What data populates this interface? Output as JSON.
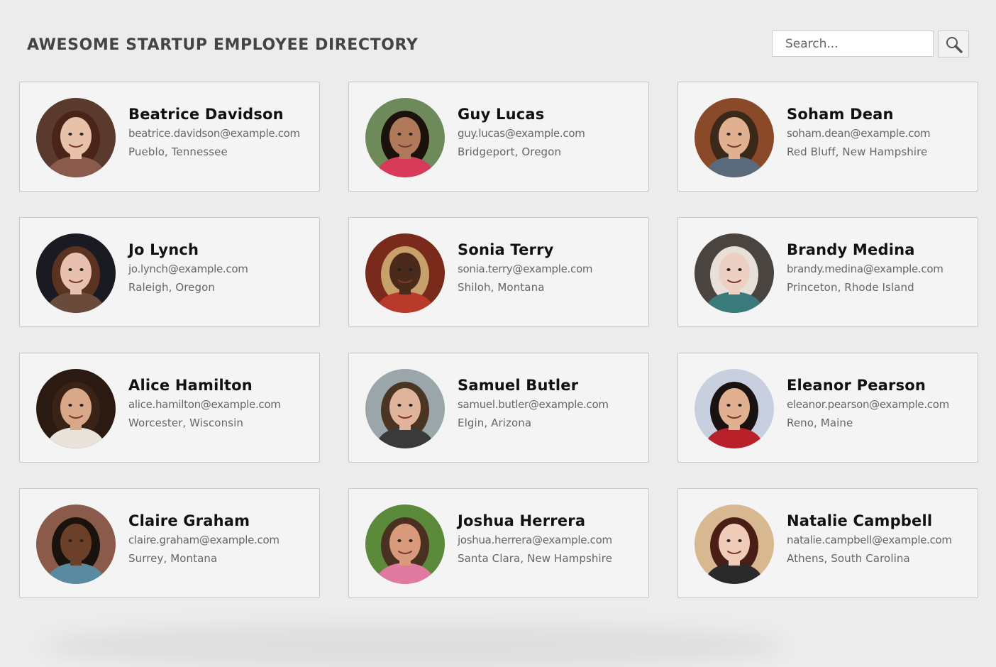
{
  "header": {
    "title": "AWESOME STARTUP EMPLOYEE DIRECTORY",
    "search_placeholder": "Search...",
    "search_icon": "magnifying-glass-icon"
  },
  "employees": [
    {
      "name": "Beatrice Davidson",
      "email": "beatrice.davidson@example.com",
      "location": "Pueblo, Tennessee",
      "colors": {
        "bg": "#5a3a2c",
        "skin": "#e8c2a8",
        "hair": "#4a2418",
        "shirt": "#8a5a4a"
      }
    },
    {
      "name": "Guy Lucas",
      "email": "guy.lucas@example.com",
      "location": "Bridgeport, Oregon",
      "colors": {
        "bg": "#6f8a5a",
        "skin": "#b07a5a",
        "hair": "#1c120c",
        "shirt": "#d83a5a"
      }
    },
    {
      "name": "Soham Dean",
      "email": "soham.dean@example.com",
      "location": "Red Bluff, New Hampshire",
      "colors": {
        "bg": "#8a4a2a",
        "skin": "#e0b090",
        "hair": "#3a2818",
        "shirt": "#5a6a7a"
      }
    },
    {
      "name": "Jo Lynch",
      "email": "jo.lynch@example.com",
      "location": "Raleigh, Oregon",
      "colors": {
        "bg": "#1a1a22",
        "skin": "#e8c0b0",
        "hair": "#5a3220",
        "shirt": "#6a4a3a"
      }
    },
    {
      "name": "Sonia Terry",
      "email": "sonia.terry@example.com",
      "location": "Shiloh, Montana",
      "colors": {
        "bg": "#7a2a1a",
        "skin": "#4a2a1a",
        "hair": "#c8a06a",
        "shirt": "#b83a2a"
      }
    },
    {
      "name": "Brandy Medina",
      "email": "brandy.medina@example.com",
      "location": "Princeton, Rhode Island",
      "colors": {
        "bg": "#4a4440",
        "skin": "#ecd0c4",
        "hair": "#e8e0d8",
        "shirt": "#3a7a7a"
      }
    },
    {
      "name": "Alice Hamilton",
      "email": "alice.hamilton@example.com",
      "location": "Worcester, Wisconsin",
      "colors": {
        "bg": "#2a1a12",
        "skin": "#d8a888",
        "hair": "#3a2214",
        "shirt": "#e8e4dc"
      }
    },
    {
      "name": "Samuel Butler",
      "email": "samuel.butler@example.com",
      "location": "Elgin, Arizona",
      "colors": {
        "bg": "#9aa6aa",
        "skin": "#e0b49a",
        "hair": "#4a3424",
        "shirt": "#3a3a3a"
      }
    },
    {
      "name": "Eleanor Pearson",
      "email": "eleanor.pearson@example.com",
      "location": "Reno, Maine",
      "colors": {
        "bg": "#c8d0e0",
        "skin": "#e0b090",
        "hair": "#1a1210",
        "shirt": "#b8202a"
      }
    },
    {
      "name": "Claire Graham",
      "email": "claire.graham@example.com",
      "location": "Surrey, Montana",
      "colors": {
        "bg": "#8a5a4a",
        "skin": "#6a4028",
        "hair": "#1a120c",
        "shirt": "#5a8aa0"
      }
    },
    {
      "name": "Joshua Herrera",
      "email": "joshua.herrera@example.com",
      "location": "Santa Clara, New Hampshire",
      "colors": {
        "bg": "#5a8a3a",
        "skin": "#d89a7a",
        "hair": "#4a3020",
        "shirt": "#e07aa0"
      }
    },
    {
      "name": "Natalie Campbell",
      "email": "natalie.campbell@example.com",
      "location": "Athens, South Carolina",
      "colors": {
        "bg": "#d8b890",
        "skin": "#f0cbb8",
        "hair": "#4a1e14",
        "shirt": "#2a2a2a"
      }
    }
  ]
}
